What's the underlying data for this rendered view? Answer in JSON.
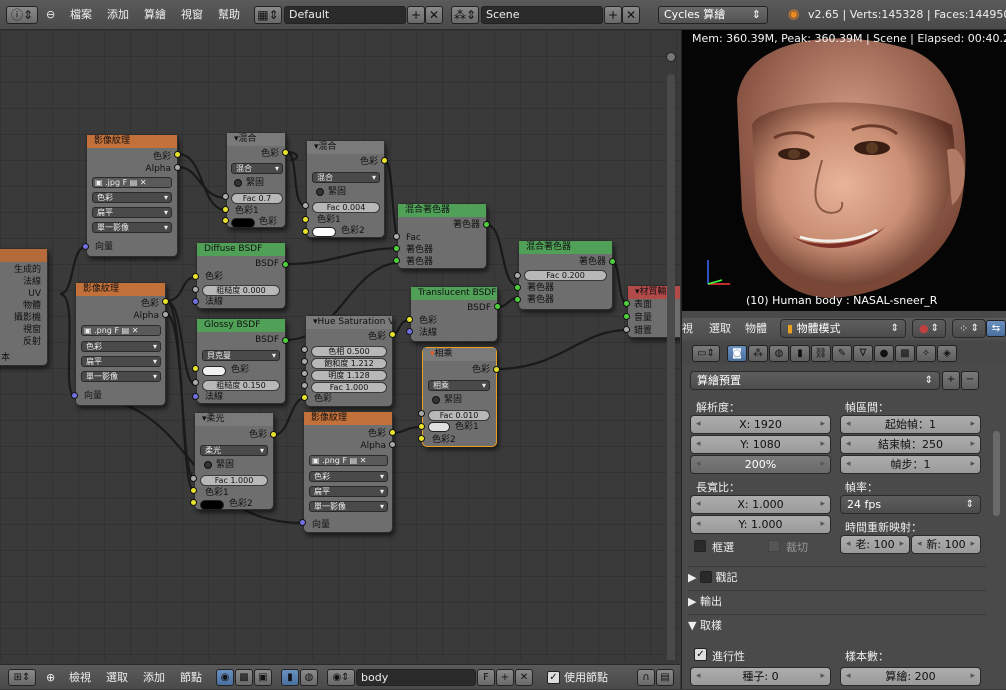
{
  "topbar": {
    "menus": [
      "檔案",
      "添加",
      "算繪",
      "視窗",
      "幫助"
    ],
    "screen_layout": "Default",
    "scene": "Scene",
    "engine": "Cycles 算繪",
    "stats": "v2.65 | Verts:145328 | Faces:144950"
  },
  "nodes": {
    "tex1": {
      "title": "影像紋理",
      "out_color": "色彩",
      "out_alpha": "Alpha",
      "image": ".jpg",
      "image_flag": "F",
      "color_space": "色彩",
      "projection": "扁平",
      "mode": "單一影像",
      "in_vector": "向量"
    },
    "tex2": {
      "title": "影像紋理",
      "out_color": "色彩",
      "out_alpha": "Alpha",
      "image": ".png",
      "image_flag": "F",
      "color_space": "色彩",
      "projection": "扁平",
      "mode": "單一影像",
      "in_vector": "向量"
    },
    "tex3": {
      "title": "影像紋理",
      "out_color": "色彩",
      "out_alpha": "Alpha",
      "image": ".png",
      "image_flag": "F",
      "color_space": "色彩",
      "projection": "扁平",
      "mode": "單一影像",
      "in_vector": "向量"
    },
    "mix1": {
      "title": "混合",
      "out": "色彩",
      "blend": "混合",
      "clamp": "緊固",
      "fac": "Fac 0.7",
      "c1": "色彩1",
      "c2": "色彩",
      "swatch": "#000000"
    },
    "mix2": {
      "title": "混合",
      "out": "色彩",
      "blend": "混合",
      "clamp": "緊固",
      "fac": "Fac 0.004",
      "c1": "色彩1",
      "c2": "色彩2",
      "swatch": "#ffffff"
    },
    "texcoord": {
      "outputs": [
        "生成的",
        "法線",
        "UV",
        "物體",
        "攝影機",
        "視窗",
        "反射"
      ],
      "extra": "本"
    },
    "diffuse": {
      "title": "Diffuse BSDF",
      "out": "BSDF",
      "color": "色彩",
      "roughness": "粗糙度 0.000",
      "normal": "法線"
    },
    "glossy": {
      "title": "Glossy BSDF",
      "out": "BSDF",
      "dist": "貝克曼",
      "color": "色彩",
      "roughness": "粗糙度 0.150",
      "normal": "法線"
    },
    "hsv": {
      "title": "Hue Saturation Va",
      "out": "色彩",
      "hue": "色相 0.500",
      "sat": "飽和度 1.212",
      "val": "明度 1.128",
      "fac": "Fac 1.000",
      "color": "色彩"
    },
    "soft": {
      "title": "柔光",
      "out": "色彩",
      "blend": "柔光",
      "clamp": "緊固",
      "fac": "Fac 1.000",
      "c1": "色彩1",
      "c2": "色彩2"
    },
    "mixsh1": {
      "title": "混合著色器",
      "out": "著色器",
      "fac": "Fac",
      "s1": "著色器",
      "s2": "著色器"
    },
    "translucent": {
      "title": "Translucent BSDF",
      "out": "BSDF",
      "color": "色彩",
      "normal": "法線"
    },
    "multiply": {
      "title": "相乘",
      "out": "色彩",
      "blend": "相乘",
      "clamp": "緊固",
      "fac": "Fac 0.010",
      "c1": "色彩1",
      "c2": "色彩2"
    },
    "mixsh2": {
      "title": "混合著色器",
      "out": "著色器",
      "fac": "Fac 0.200",
      "s1": "著色器",
      "s2": "著色器"
    },
    "output": {
      "title": "材質輸",
      "surface": "表面",
      "volume": "音量",
      "disp": "錯置"
    }
  },
  "bottombar": {
    "menus": [
      "檢視",
      "選取",
      "添加",
      "節點"
    ],
    "material": "body",
    "material_flag": "F",
    "use_nodes": "使用節點"
  },
  "viewport": {
    "status": "Mem: 360.39M, Peak: 360.39M | Scene | Elapsed: 00:40.26 | F",
    "object": "(10) Human body : NASAL-sneer_R"
  },
  "properties": {
    "header_menus": [
      "視",
      "選取",
      "物體"
    ],
    "mode": "物體模式",
    "render_preset": "算繪預置",
    "resolution_label": "解析度：",
    "res_x": "X: 1920",
    "res_y": "Y: 1080",
    "res_pct": "200%",
    "frame_range_label": "幀區間：",
    "start": "起始幀：1",
    "end": "結束幀：250",
    "step": "幀步：1",
    "aspect_label": "長寬比：",
    "aspect_x": "X: 1.000",
    "aspect_y": "Y: 1.000",
    "framerate_label": "幀率：",
    "fps": "24 fps",
    "remap_label": "時間重新映射：",
    "remap_old": "老: 100",
    "remap_new": "新: 100",
    "border": "框選",
    "crop": "裁切",
    "stamp": "戳記",
    "output": "輸出",
    "sampling": "取樣",
    "progressive": "進行性",
    "samples_label": "樣本數：",
    "seed": "種子: 0",
    "render_samples": "算繪: 200"
  }
}
